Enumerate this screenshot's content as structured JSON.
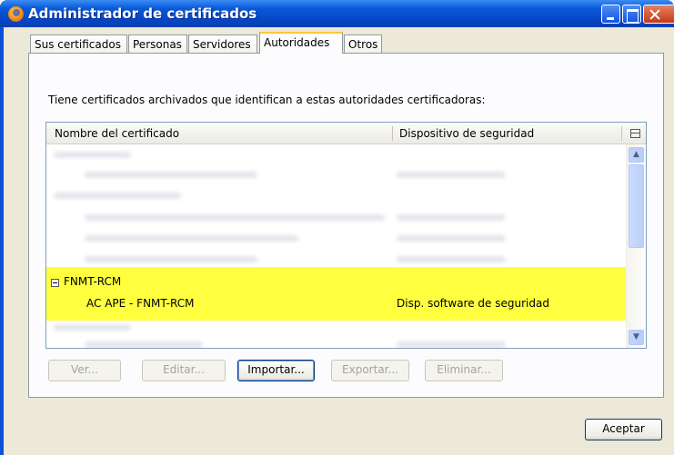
{
  "window": {
    "title": "Administrador de certificados"
  },
  "tabs": [
    {
      "label": "Sus certificados",
      "active": false
    },
    {
      "label": "Personas",
      "active": false
    },
    {
      "label": "Servidores",
      "active": false
    },
    {
      "label": "Autoridades",
      "active": true
    },
    {
      "label": "Otros",
      "active": false
    }
  ],
  "panel": {
    "description": "Tiene certificados archivados que identifican a estas autoridades certificadoras:"
  },
  "table": {
    "columns": [
      "Nombre del certificado",
      "Dispositivo de seguridad"
    ],
    "highlighted_group": {
      "name": "FNMT-RCM",
      "items": [
        {
          "name": "AC APE - FNMT-RCM",
          "device": "Disp. software de seguridad"
        }
      ]
    }
  },
  "buttons": {
    "ver": "Ver...",
    "editar": "Editar...",
    "importar": "Importar...",
    "exportar": "Exportar...",
    "eliminar": "Eliminar...",
    "aceptar": "Aceptar"
  },
  "colors": {
    "highlight": "#ffff3f",
    "titlebar": "#0a53d9"
  }
}
